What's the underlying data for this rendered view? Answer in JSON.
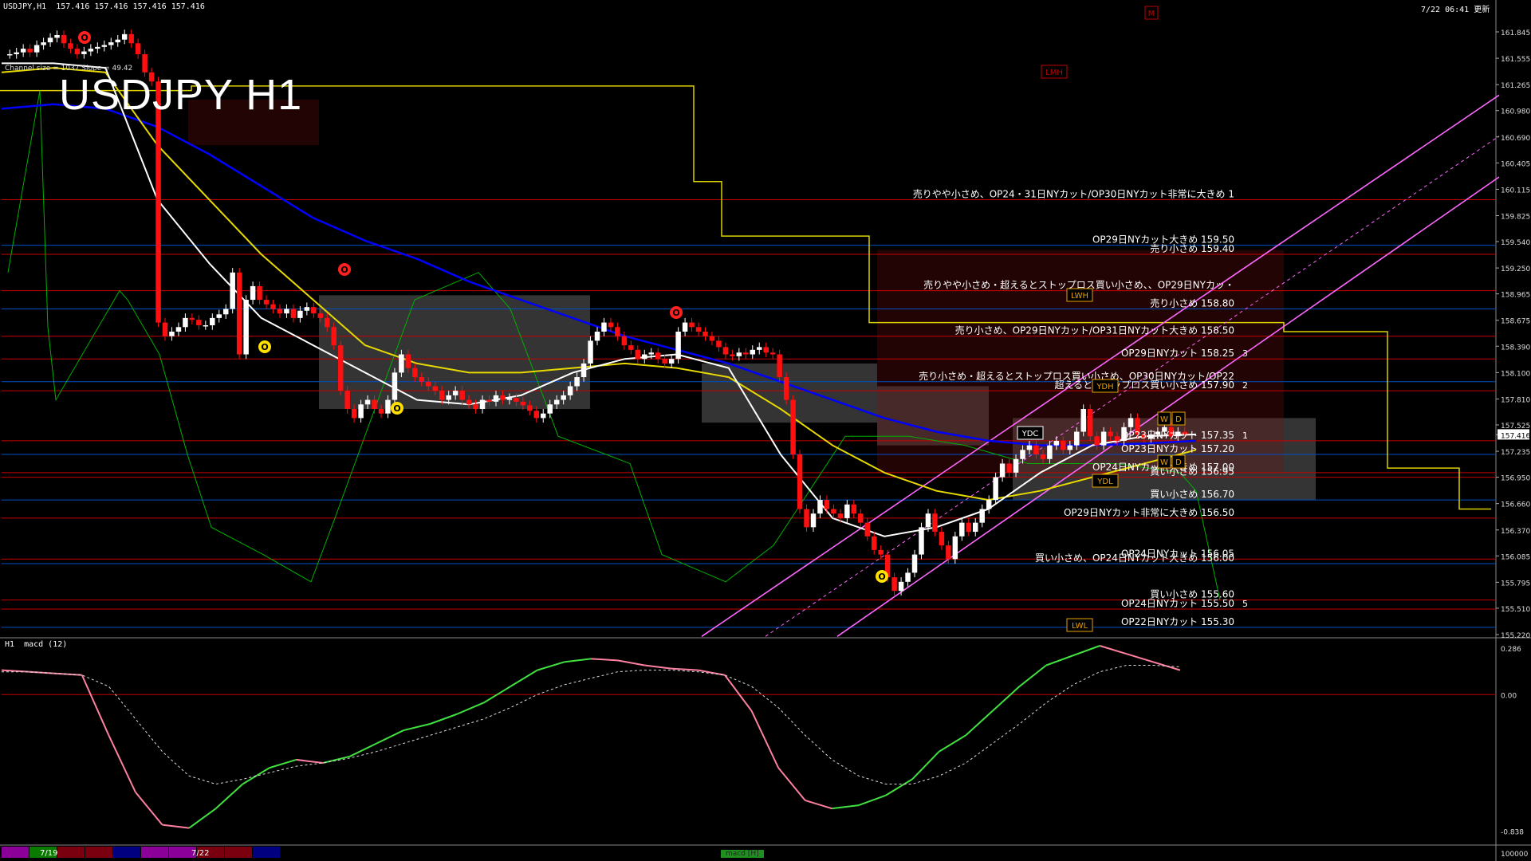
{
  "header": {
    "symbol_info": "USDJPY,H1  157.416 157.416 157.416 157.416",
    "timestamp": "7/22 06:41 更新",
    "big_title": "USDJPY H1",
    "channel_info": "Channel size = 1037 Slope = 49.42"
  },
  "macd_panel": {
    "label": "H1  macd (12)",
    "scale": [
      "0.286",
      "0.00",
      "-0.838"
    ],
    "bottom_right": "100000",
    "tab": "macd [H]"
  },
  "timeline": {
    "labels": [
      "7/19",
      "7/22"
    ],
    "segment_colors": [
      "#8a0099",
      "#0a7a00",
      "#7a0010",
      "#7a0010",
      "#000080",
      "#8a0099",
      "#8a0099",
      "#7a0010",
      "#7a0010",
      "#000080"
    ]
  },
  "markers": {
    "lmh": "LMH",
    "lwh": "LWH",
    "ydh": "YDH",
    "ydc": "YDC",
    "ydl": "YDL",
    "lwl": "LWL",
    "m": "M",
    "w": "W",
    "d": "D",
    "o": "O"
  },
  "chart_data": {
    "type": "line",
    "title": "USDJPY H1",
    "price_axis": [
      "161.845",
      "161.555",
      "161.265",
      "160.980",
      "160.690",
      "160.405",
      "160.115",
      "159.825",
      "159.540",
      "159.250",
      "158.965",
      "158.675",
      "158.390",
      "158.100",
      "157.810",
      "157.525",
      "157.416",
      "157.235",
      "156.950",
      "156.660",
      "156.370",
      "156.085",
      "155.795",
      "155.510",
      "155.220"
    ],
    "current_price": "157.416",
    "ylim": [
      155.22,
      161.88
    ],
    "levels": [
      {
        "price": 160.0,
        "label": "売りやや小さめ、OP24・31日NYカット/OP30日NYカット非常に大きめ 1"
      },
      {
        "price": 159.5,
        "label": "OP29日NYカット大きめ 159.50"
      },
      {
        "price": 159.4,
        "label": "売り小さめ 159.40"
      },
      {
        "price": 159.0,
        "label": "売りやや小さめ・超えるとストップロス買い小さめ、、OP29日NYカッ・"
      },
      {
        "price": 158.8,
        "label": "売り小さめ 158.80"
      },
      {
        "price": 158.5,
        "label": "売り小さめ、OP29日NYカット/OP31日NYカット大きめ 158.50"
      },
      {
        "price": 158.25,
        "label": "OP29日NYカット 158.25",
        "tag": "3"
      },
      {
        "price": 158.0,
        "label": "売り小さめ・超えるとストップロス買い小さめ、OP30日NYカット/OP22"
      },
      {
        "price": 157.9,
        "label": "超えるとストップロス買い小さめ 157.90",
        "tag": "2"
      },
      {
        "price": 157.35,
        "label": "OP23日NYカット 157.35",
        "tag": "1"
      },
      {
        "price": 157.2,
        "label": "OP23日NYカット 157.20"
      },
      {
        "price": 157.0,
        "label": "OP24日NYカット大きめ 157.00"
      },
      {
        "price": 156.95,
        "label": "買い小さめ 156.95"
      },
      {
        "price": 156.7,
        "label": "買い小さめ 156.70"
      },
      {
        "price": 156.5,
        "label": "OP29日NYカット非常に大きめ 156.50"
      },
      {
        "price": 156.05,
        "label": "OP24日NYカット 156.05"
      },
      {
        "price": 156.0,
        "label": "買い小さめ、OP24日NYカット大きめ 156.00"
      },
      {
        "price": 155.6,
        "label": "買い小さめ 155.60"
      },
      {
        "price": 155.5,
        "label": "OP24日NYカット 155.50",
        "tag": "5"
      },
      {
        "price": 155.3,
        "label": "OP22日NYカット 155.30"
      }
    ],
    "candles": [
      161.6,
      161.62,
      161.66,
      161.62,
      161.7,
      161.73,
      161.78,
      161.81,
      161.72,
      161.66,
      161.6,
      161.63,
      161.66,
      161.68,
      161.7,
      161.73,
      161.76,
      161.82,
      161.72,
      161.6,
      161.4,
      161.3,
      158.65,
      158.5,
      158.55,
      158.6,
      158.7,
      158.68,
      158.62,
      158.62,
      158.7,
      158.74,
      158.8,
      159.2,
      158.3,
      158.9,
      159.05,
      158.9,
      158.85,
      158.8,
      158.75,
      158.8,
      158.7,
      158.78,
      158.82,
      158.75,
      158.7,
      158.6,
      158.4,
      157.9,
      157.7,
      157.6,
      157.75,
      157.8,
      157.7,
      157.65,
      157.8,
      158.1,
      158.3,
      158.15,
      158.05,
      158.0,
      157.95,
      157.9,
      157.8,
      157.85,
      157.9,
      157.8,
      157.75,
      157.7,
      157.8,
      157.78,
      157.85,
      157.8,
      157.82,
      157.78,
      157.74,
      157.68,
      157.6,
      157.65,
      157.75,
      157.8,
      157.85,
      157.95,
      158.05,
      158.2,
      158.45,
      158.55,
      158.65,
      158.6,
      158.5,
      158.4,
      158.35,
      158.25,
      158.3,
      158.32,
      158.25,
      158.2,
      158.25,
      158.55,
      158.65,
      158.6,
      158.55,
      158.5,
      158.45,
      158.38,
      158.3,
      158.28,
      158.32,
      158.3,
      158.35,
      158.38,
      158.32,
      158.3,
      158.05,
      157.8,
      157.2,
      156.6,
      156.4,
      156.55,
      156.7,
      156.6,
      156.55,
      156.5,
      156.65,
      156.55,
      156.45,
      156.3,
      156.15,
      156.1,
      155.85,
      155.7,
      155.8,
      155.9,
      156.1,
      156.4,
      156.55,
      156.35,
      156.2,
      156.05,
      156.3,
      156.45,
      156.35,
      156.45,
      156.6,
      156.7,
      156.95,
      157.1,
      157.0,
      157.15,
      157.25,
      157.3,
      157.2,
      157.15,
      157.3,
      157.35,
      157.25,
      157.3,
      157.45,
      157.7,
      157.4,
      157.3,
      157.45,
      157.4,
      157.35,
      157.5,
      157.6,
      157.42,
      157.38,
      157.42,
      157.45,
      157.5,
      157.4,
      157.45,
      157.42
    ],
    "ma_white": [
      161.5,
      161.5,
      161.45,
      160.0,
      159.3,
      158.7,
      158.4,
      158.1,
      157.8,
      157.75,
      157.85,
      158.1,
      158.25,
      158.3,
      158.15,
      157.2,
      156.5,
      156.3,
      156.4,
      156.6,
      157.0,
      157.3,
      157.4,
      157.42
    ],
    "ma_yellow": [
      161.4,
      161.45,
      161.4,
      160.6,
      160.0,
      159.4,
      158.9,
      158.4,
      158.2,
      158.1,
      158.1,
      158.15,
      158.2,
      158.15,
      158.05,
      157.7,
      157.3,
      157.0,
      156.8,
      156.7,
      156.8,
      156.95,
      157.1,
      157.25
    ],
    "ma_blue": [
      161.0,
      161.05,
      161.0,
      160.8,
      160.5,
      160.15,
      159.8,
      159.55,
      159.35,
      159.1,
      158.9,
      158.7,
      158.5,
      158.35,
      158.2,
      158.0,
      157.8,
      157.6,
      157.45,
      157.35,
      157.3,
      157.3,
      157.32,
      157.35
    ],
    "macd": {
      "main": [
        0.15,
        0.14,
        0.13,
        0.12,
        -0.25,
        -0.6,
        -0.8,
        -0.82,
        -0.7,
        -0.55,
        -0.45,
        -0.4,
        -0.42,
        -0.38,
        -0.3,
        -0.22,
        -0.18,
        -0.12,
        -0.05,
        0.05,
        0.15,
        0.2,
        0.22,
        0.21,
        0.18,
        0.16,
        0.15,
        0.12,
        -0.1,
        -0.45,
        -0.65,
        -0.7,
        -0.68,
        -0.62,
        -0.52,
        -0.35,
        -0.25,
        -0.1,
        0.05,
        0.18,
        0.24,
        0.3,
        0.25,
        0.2,
        0.15
      ],
      "signal": [
        0.14,
        0.14,
        0.13,
        0.12,
        0.05,
        -0.15,
        -0.35,
        -0.5,
        -0.55,
        -0.52,
        -0.48,
        -0.44,
        -0.42,
        -0.39,
        -0.35,
        -0.3,
        -0.25,
        -0.2,
        -0.15,
        -0.08,
        0.0,
        0.06,
        0.1,
        0.14,
        0.15,
        0.15,
        0.14,
        0.12,
        0.05,
        -0.08,
        -0.25,
        -0.4,
        -0.5,
        -0.55,
        -0.55,
        -0.5,
        -0.42,
        -0.3,
        -0.18,
        -0.05,
        0.06,
        0.14,
        0.18,
        0.18,
        0.17
      ],
      "ylim": [
        -0.9,
        0.3
      ]
    }
  },
  "colors": {
    "level_red": "#c80000",
    "level_blue": "#0050c8",
    "candle_up": "#ffffff",
    "candle_down": "#ff1010",
    "ma_white": "#ffffff",
    "ma_yellow": "#e6d800",
    "ma_blue": "#0000ff",
    "ichimoku_span": "#dcd000",
    "channel": "#ff66ff",
    "green_line": "#00b000",
    "macd_up": "#40e040",
    "macd_down": "#ff80a0"
  }
}
